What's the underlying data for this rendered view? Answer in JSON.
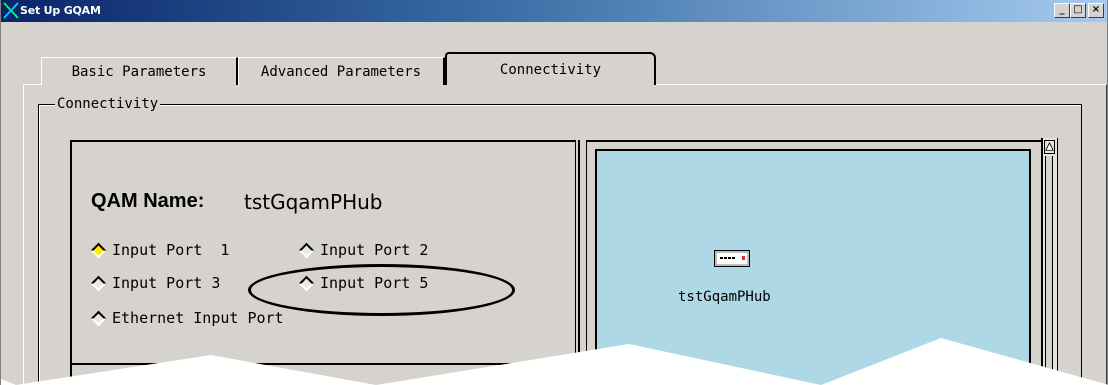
{
  "window": {
    "title": "Set Up GQAM",
    "controls": {
      "minimize": "_",
      "maximize": "□",
      "close": "×"
    }
  },
  "tabs": [
    {
      "label": "Basic Parameters",
      "selected": false
    },
    {
      "label": "Advanced Parameters",
      "selected": false
    },
    {
      "label": "Connectivity",
      "selected": true
    }
  ],
  "connectivity": {
    "group_label": "Connectivity",
    "qam_name_label": "QAM Name:",
    "qam_name_value": "tstGqamPHub",
    "ports": [
      {
        "label": "Input Port  1",
        "selected": true
      },
      {
        "label": "Input Port 2",
        "selected": false
      },
      {
        "label": "Input Port 3",
        "selected": false
      },
      {
        "label": "Input Port 5",
        "selected": false
      },
      {
        "label": "Ethernet Input Port",
        "selected": false
      }
    ],
    "diagram": {
      "background": "#aed8e5",
      "device_label": "tstGqamPHub",
      "device_icon": "qam-device-icon"
    }
  },
  "colors": {
    "titlebar_start": "#0a246a",
    "titlebar_end": "#a6caf0",
    "selected_radio": "#ffe600"
  }
}
